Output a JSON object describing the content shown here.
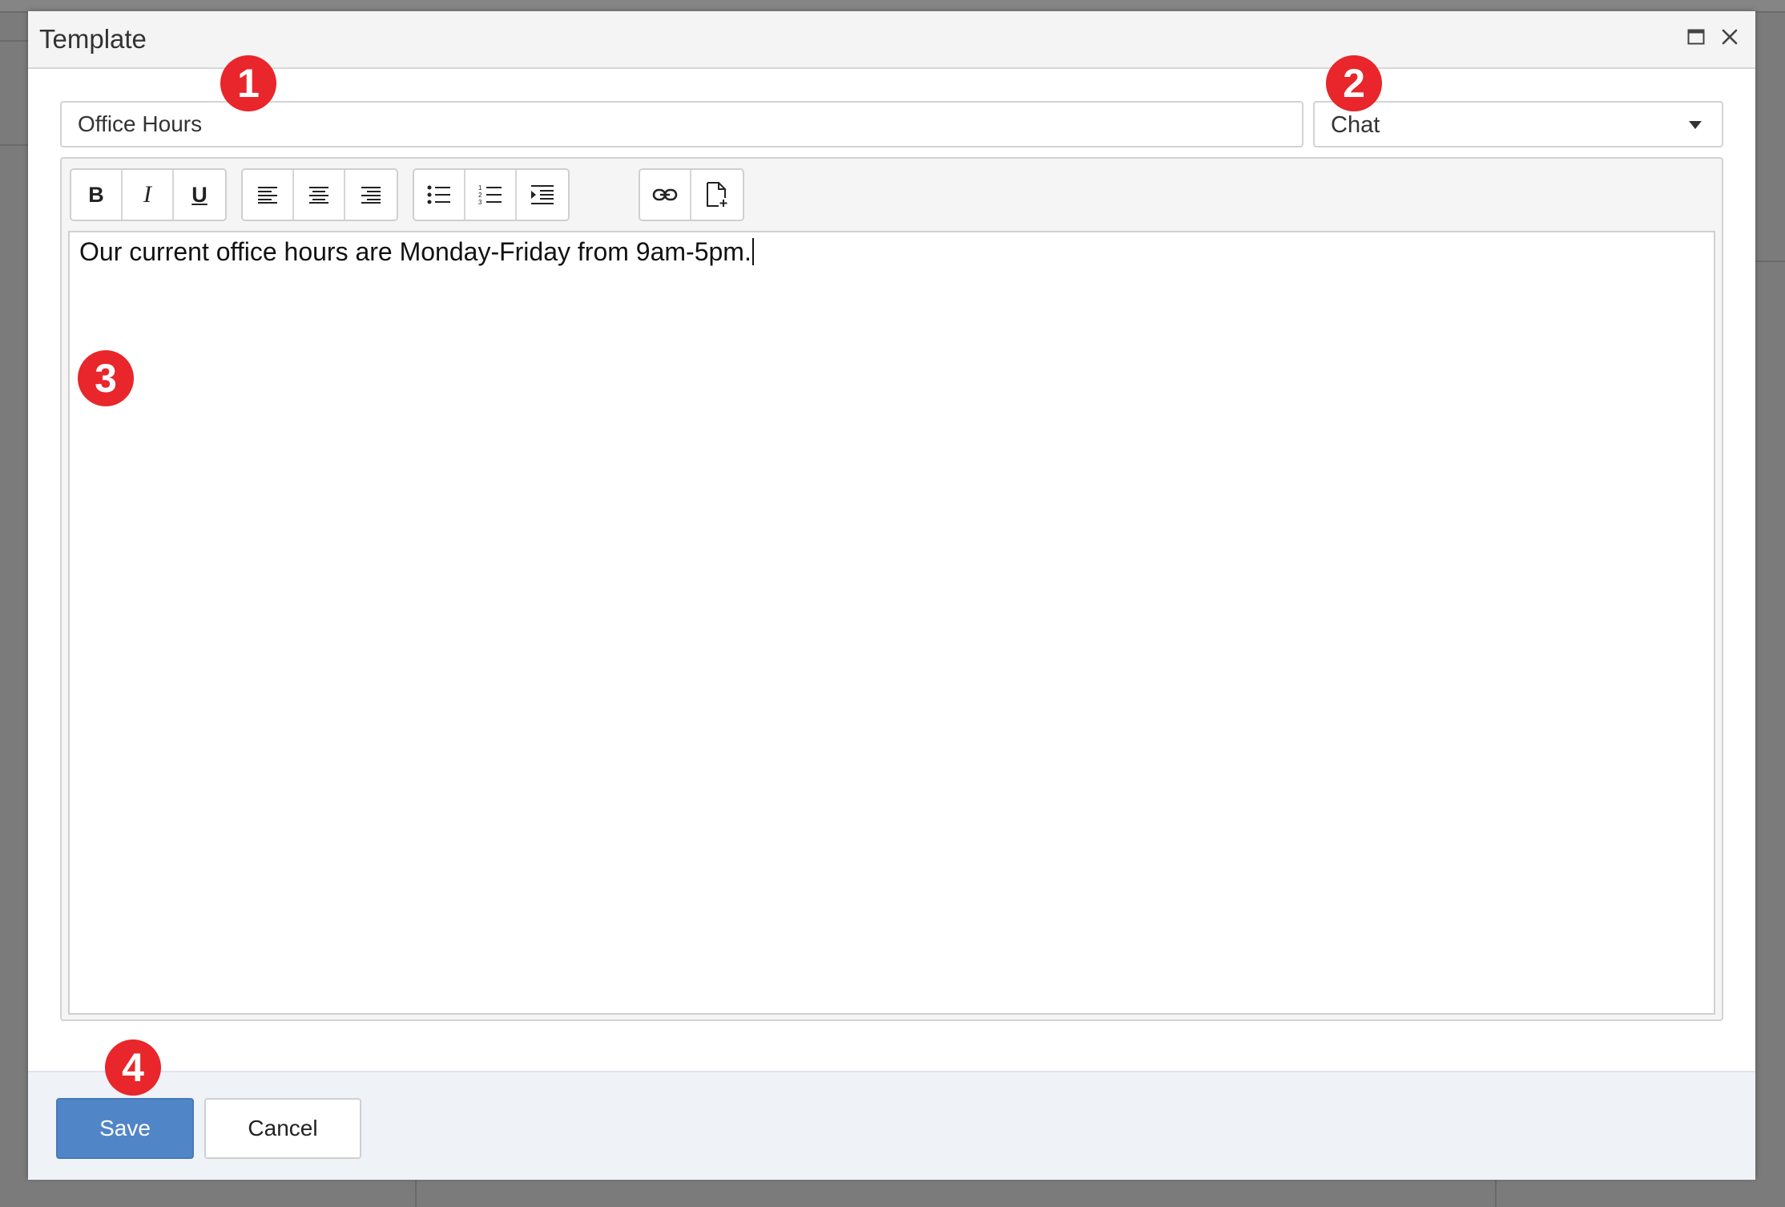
{
  "dialog": {
    "title": "Template",
    "maximize_icon": "maximize-icon",
    "close_icon": "close-icon"
  },
  "form": {
    "name_value": "Office Hours",
    "type_value": "Chat"
  },
  "toolbar": {
    "bold_label": "B",
    "italic_label": "I",
    "underline_label": "U",
    "icons": [
      "align-left-icon",
      "align-center-icon",
      "align-right-icon",
      "bullet-list-icon",
      "numbered-list-icon",
      "indent-icon",
      "link-icon",
      "insert-document-icon"
    ]
  },
  "editor": {
    "content": "Our current office hours are Monday-Friday from 9am-5pm."
  },
  "footer": {
    "save_label": "Save",
    "cancel_label": "Cancel"
  },
  "annotations": {
    "badge_1": "1",
    "badge_2": "2",
    "badge_3": "3",
    "badge_4": "4",
    "badge_color": "#e8262b"
  },
  "colors": {
    "primary_button": "#5085c7",
    "footer_bg": "#eff2f7"
  }
}
